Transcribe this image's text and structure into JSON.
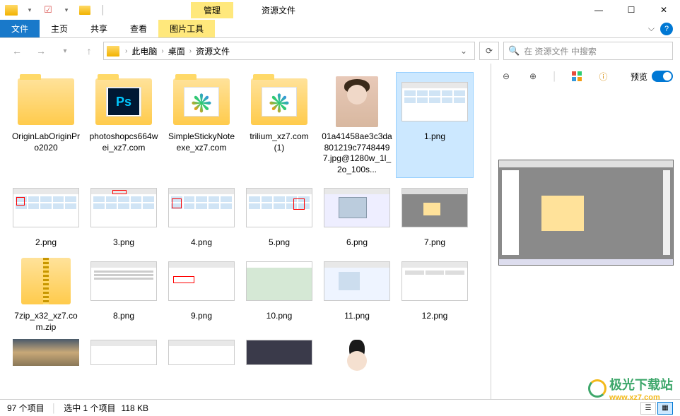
{
  "titlebar": {
    "context_tab": "管理",
    "title": "资源文件"
  },
  "ribbon": {
    "file": "文件",
    "home": "主页",
    "share": "共享",
    "view": "查看",
    "pictools": "图片工具"
  },
  "address": {
    "crumb1": "此电脑",
    "crumb2": "桌面",
    "crumb3": "资源文件",
    "search_placeholder": "在 资源文件 中搜索"
  },
  "preview": {
    "label": "预览"
  },
  "items": [
    {
      "name": "OriginLabOriginPro2020"
    },
    {
      "name": "photoshopcs664wei_xz7.com"
    },
    {
      "name": "SimpleStickyNoteexe_xz7.com"
    },
    {
      "name": "trilium_xz7.com (1)"
    },
    {
      "name": "01a41458ae3c3da801219c77484497.jpg@1280w_1l_2o_100s..."
    },
    {
      "name": "1.png"
    },
    {
      "name": "2.png"
    },
    {
      "name": "3.png"
    },
    {
      "name": "4.png"
    },
    {
      "name": "5.png"
    },
    {
      "name": "6.png"
    },
    {
      "name": "7.png"
    },
    {
      "name": "7zip_x32_xz7.com.zip"
    },
    {
      "name": "8.png"
    },
    {
      "name": "9.png"
    },
    {
      "name": "10.png"
    },
    {
      "name": "11.png"
    },
    {
      "name": "12.png"
    }
  ],
  "status": {
    "count": "97 个项目",
    "selection": "选中 1 个项目",
    "size": "118 KB"
  },
  "watermark": {
    "text": "极光下载站",
    "url": "www.xz7.com"
  }
}
